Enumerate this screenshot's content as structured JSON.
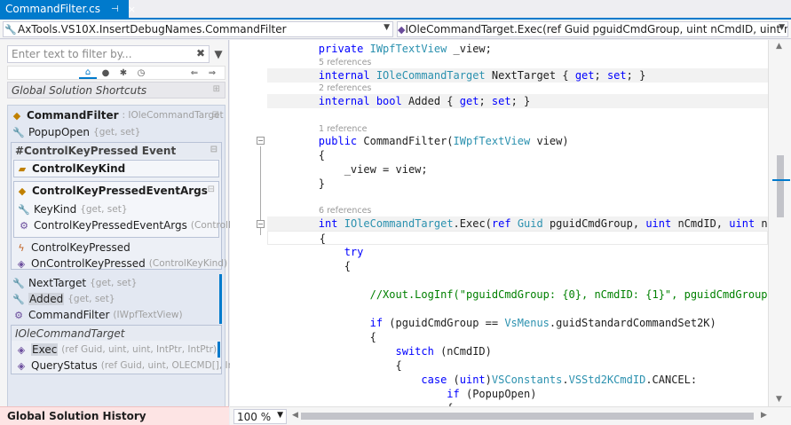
{
  "tab": {
    "title": "CommandFilter.cs",
    "pin": "⊣",
    "close": "×"
  },
  "navbar": {
    "left_combo": "AxTools.VS10X.InsertDebugNames.CommandFilter",
    "right_combo": "IOleCommandTarget.Exec(ref Guid pguidCmdGroup, uint nCmdID, uint nCm"
  },
  "left_panel": {
    "filter_placeholder": "Enter text to filter by...",
    "global_solution_shortcuts": "Global Solution Shortcuts",
    "class_name": "CommandFilter",
    "class_base": ": IOleCommandTarget",
    "popup_open": "PopupOpen",
    "popup_open_acc": "{get, set}",
    "event_region": "#ControlKeyPressed Event",
    "control_key_kind": "ControlKeyKind",
    "args_class": "ControlKeyPressedEventArgs",
    "key_kind": "KeyKind",
    "key_kind_acc": "{get, set}",
    "args_ctor": "ControlKeyPressedEventArgs",
    "args_ctor_params": "(ControlKeyK",
    "control_key_pressed": "ControlKeyPressed",
    "on_control_key_pressed": "OnControlKeyPressed",
    "on_control_key_pressed_params": "(ControlKeyKind)",
    "next_target": "NextTarget",
    "next_target_acc": "{get, set}",
    "added": "Added",
    "added_acc": "{get, set}",
    "ctor": "CommandFilter",
    "ctor_params": "(IWpfTextView)",
    "interface_region": "IOleCommandTarget",
    "exec": "Exec",
    "exec_params": "(ref Guid, uint, uint, IntPtr, IntPtr)",
    "query_status": "QueryStatus",
    "query_status_params": "(ref Guid, uint, OLECMD[], IntPtr)",
    "history": "Global Solution History"
  },
  "editor": {
    "zoom": "100 %",
    "lens": {
      "l0": "5 references",
      "l1": "2 references",
      "l2": "1 reference",
      "l3": "6 references"
    }
  }
}
